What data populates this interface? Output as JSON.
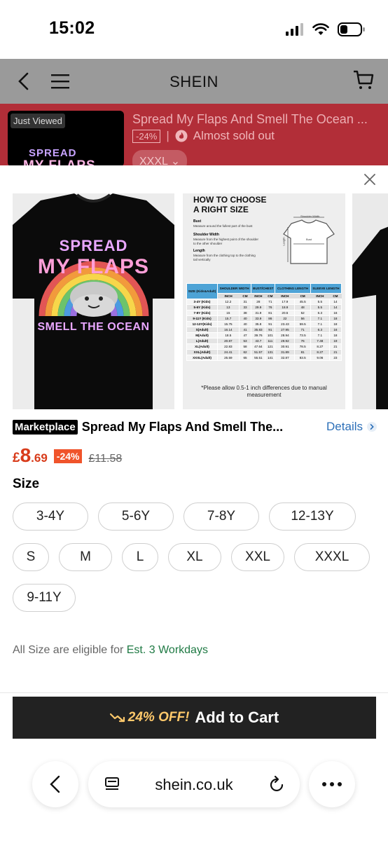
{
  "status": {
    "time": "15:02"
  },
  "header": {
    "title": "SHEIN"
  },
  "just_viewed": {
    "label": "Just Viewed",
    "title": "Spread My Flaps And Smell The Ocean ...",
    "discount": "-24%",
    "stock_status": "Almost sold out",
    "size": "XXXL",
    "thumb_text_1": "SPREAD",
    "thumb_text_2": "MY FLAPS"
  },
  "gallery": {
    "shirt_text": [
      "SPREAD",
      "MY FLAPS",
      "SMELL THE OCEAN"
    ],
    "size_chart": {
      "title": "HOW TO CHOOSE\nA RIGHT SIZE",
      "bust_label": "Bust",
      "bust_desc": "Measure around the fullest part of the bust",
      "shoulder_label": "Shoulder Width",
      "shoulder_desc": "Measure from the highest point of the shoulder to the other shoulder",
      "length_label": "Length",
      "length_desc": "Measure from the clothing top to the clothing tail vertically",
      "diagram_labels": {
        "shoulder": "Shoulder Width",
        "bust": "Bust",
        "length": "Length"
      },
      "columns": [
        "SIZE (Kids&Adult)",
        "SHOULDER WIDTH",
        "BUST/CHEST",
        "CLOTHING LENGTH",
        "SLEEVE LENGTH"
      ],
      "units": [
        "INCH",
        "CM",
        "INCH",
        "CM",
        "INCH",
        "CM",
        "INCH",
        "CM"
      ],
      "rows": [
        [
          "3-4Y (Kids)",
          "12.2",
          "31",
          "28",
          "71",
          "17.9",
          "45.5",
          "5.5",
          "14"
        ],
        [
          "5-6Y (Kids)",
          "13",
          "33",
          "29.9",
          "76",
          "18.9",
          "48",
          "5.5",
          "14"
        ],
        [
          "7-8Y (Kids)",
          "15",
          "38",
          "31.9",
          "81",
          "20.5",
          "52",
          "6.3",
          "16"
        ],
        [
          "9-11Y (Kids)",
          "15.7",
          "40",
          "33.9",
          "86",
          "22",
          "56",
          "7.1",
          "18"
        ],
        [
          "12-13Y(Kids)",
          "15.75",
          "40",
          "35.8",
          "91",
          "23.43",
          "59.5",
          "7.1",
          "18"
        ],
        [
          "S(Adult)",
          "16.14",
          "41",
          "35.83",
          "91",
          "27.95",
          "71",
          "6.3",
          "16"
        ],
        [
          "M(Adult)",
          "18.5",
          "47",
          "39.76",
          "101",
          "28.94",
          "73.5",
          "7.1",
          "18"
        ],
        [
          "L(Adult)",
          "20.87",
          "53",
          "43.7",
          "111",
          "29.92",
          "76",
          "7.48",
          "19"
        ],
        [
          "XL(Adult)",
          "22.83",
          "58",
          "47.64",
          "121",
          "30.91",
          "78.5",
          "8.27",
          "21"
        ],
        [
          "XXL(Adult)",
          "24.41",
          "62",
          "51.57",
          "131",
          "31.89",
          "81",
          "8.27",
          "21"
        ],
        [
          "XXXL(Adult)",
          "25.59",
          "65",
          "55.51",
          "141",
          "32.87",
          "83.5",
          "9.06",
          "23"
        ]
      ],
      "note": "*Please allow 0.5-1 inch differences due to manual measurement"
    }
  },
  "product": {
    "badge": "Marketplace",
    "name": "Spread My Flaps And Smell The...",
    "details_label": "Details",
    "price_currency": "£",
    "price_int": "8",
    "price_dec": ".69",
    "discount": "-24%",
    "original_price": "£11.58"
  },
  "sizes": {
    "title": "Size",
    "options": [
      "3-4Y",
      "5-6Y",
      "7-8Y",
      "12-13Y",
      "S",
      "M",
      "L",
      "XL",
      "XXL",
      "XXXL",
      "9-11Y"
    ]
  },
  "delivery": {
    "prefix": "All Size are eligible for",
    "estimate": "Est. 3 Workdays"
  },
  "cta": {
    "off_label": "24% OFF!",
    "label": "Add to Cart"
  },
  "browser": {
    "domain": "shein.co.uk"
  },
  "colors": {
    "accent": "#d83b1a",
    "banner": "#b22e38",
    "cta_bg": "#222222",
    "link": "#2c6fb8",
    "eta": "#1f7a44"
  }
}
